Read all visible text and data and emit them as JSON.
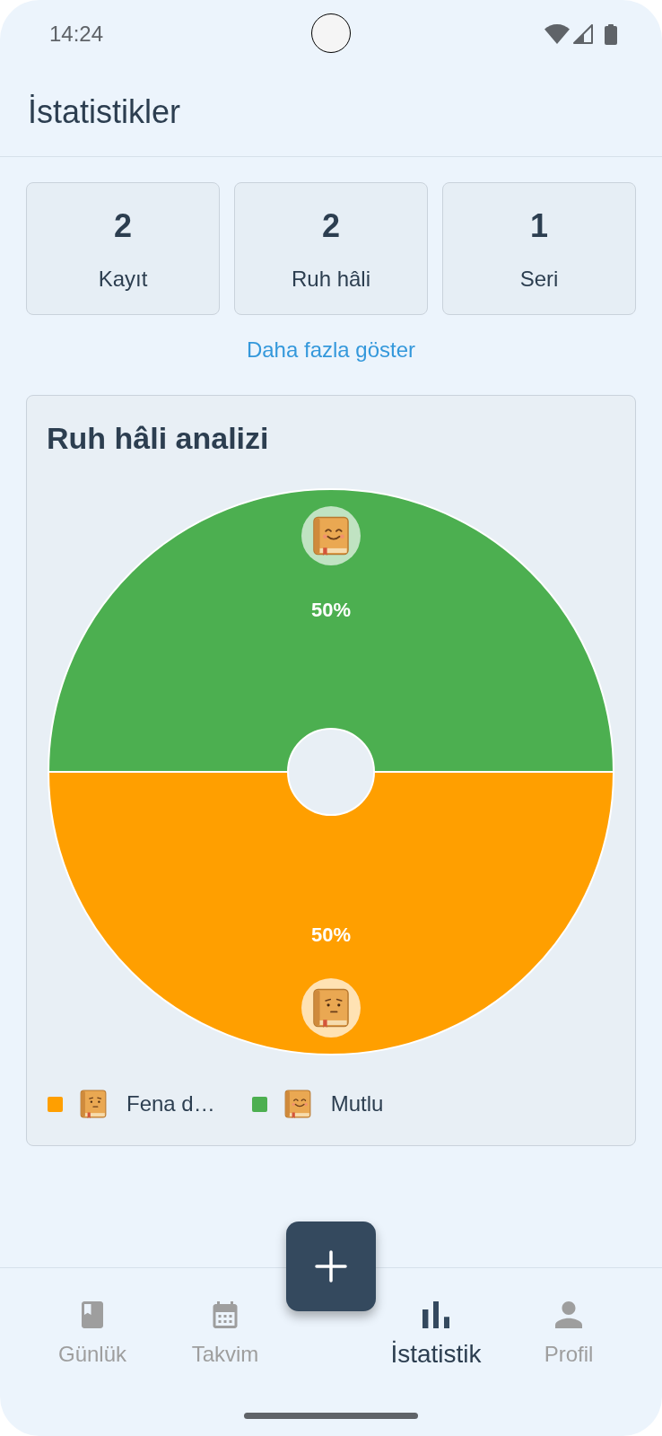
{
  "status_bar": {
    "time": "14:24"
  },
  "app_bar": {
    "title": "İstatistikler"
  },
  "stats": [
    {
      "value": "2",
      "label": "Kayıt"
    },
    {
      "value": "2",
      "label": "Ruh hâli"
    },
    {
      "value": "1",
      "label": "Seri"
    }
  ],
  "show_more_link": "Daha fazla göster",
  "mood_chart": {
    "title": "Ruh hâli analizi",
    "chart_data": {
      "type": "donut",
      "categories": [
        "Fena d…",
        "Mutlu"
      ],
      "series": [
        {
          "values": [
            50,
            50
          ]
        }
      ],
      "value_labels": [
        "50%",
        "50%"
      ],
      "colors": [
        "#ff9f00",
        "#4caf50"
      ]
    },
    "moods": [
      {
        "kind": "neutral"
      },
      {
        "kind": "happy"
      }
    ]
  },
  "nav": {
    "tabs": [
      {
        "label": "Günlük",
        "kind": "journal",
        "selected": false
      },
      {
        "label": "Takvim",
        "kind": "calendar",
        "selected": false
      },
      {
        "label": "İstatistik",
        "kind": "stats",
        "selected": true
      },
      {
        "label": "Profil",
        "kind": "profile",
        "selected": false
      }
    ]
  }
}
